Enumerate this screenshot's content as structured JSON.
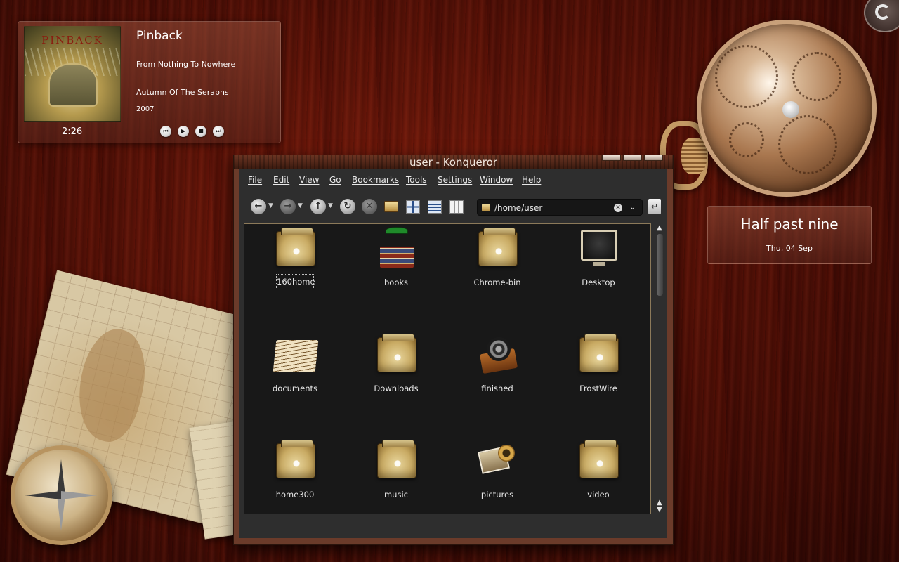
{
  "player": {
    "album_art_text": "PINBACK",
    "artist": "Pinback",
    "album": "From Nothing To Nowhere",
    "track": "Autumn Of The Seraphs",
    "year": "2007",
    "elapsed": "2:26",
    "controls": [
      {
        "name": "previous-button",
        "glyph": "⏮"
      },
      {
        "name": "play-button",
        "glyph": "▶"
      },
      {
        "name": "stop-button",
        "glyph": "■"
      },
      {
        "name": "next-button",
        "glyph": "⏭"
      }
    ]
  },
  "clock": {
    "time_text": "Half past nine",
    "date_text": "Thu, 04 Sep"
  },
  "window": {
    "title": "user - Konqueror",
    "menu": [
      "File",
      "Edit",
      "View",
      "Go",
      "Bookmarks",
      "Tools",
      "Settings",
      "Window",
      "Help"
    ],
    "toolbar_icons": {
      "back": "back-arrow-icon",
      "forward": "forward-arrow-icon",
      "up": "up-arrow-icon",
      "reload": "reload-icon",
      "stop": "stop-icon",
      "home": "home-folder-icon",
      "icon_view": "icon-view-icon",
      "detail_view": "detail-view-icon",
      "column_view": "column-view-icon"
    },
    "location": "/home/user",
    "files": [
      {
        "label": "160home",
        "icon": "folder"
      },
      {
        "label": "books",
        "icon": "books"
      },
      {
        "label": "Chrome-bin",
        "icon": "folder"
      },
      {
        "label": "Desktop",
        "icon": "monitor"
      },
      {
        "label": "documents",
        "icon": "documents"
      },
      {
        "label": "Downloads",
        "icon": "folder"
      },
      {
        "label": "finished",
        "icon": "film-reel"
      },
      {
        "label": "FrostWire",
        "icon": "folder"
      },
      {
        "label": "home300",
        "icon": "folder"
      },
      {
        "label": "music",
        "icon": "folder"
      },
      {
        "label": "pictures",
        "icon": "photos"
      },
      {
        "label": "video",
        "icon": "folder"
      }
    ]
  },
  "colors": {
    "wood": "#4e0f06",
    "panel_bg": "#2e2e2e",
    "view_bg": "#181818",
    "text": "#e8e8e8"
  }
}
